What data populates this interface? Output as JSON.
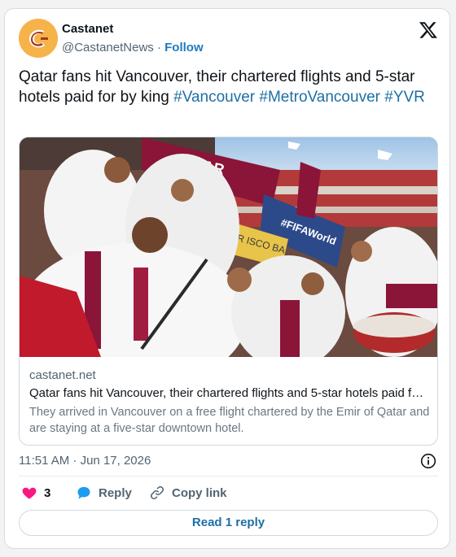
{
  "author": {
    "name": "Castanet",
    "handle": "@CastanetNews",
    "separator": "·",
    "follow_label": "Follow"
  },
  "tweet": {
    "text": "Qatar fans hit Vancouver, their chartered flights and 5-star hotels paid for by king",
    "hashtags": [
      "#Vancouver",
      "#MetroVancouver",
      "#YVR"
    ]
  },
  "link_card": {
    "domain": "castanet.net",
    "title": "Qatar fans hit Vancouver, their chartered flights and 5-star hotels paid f…",
    "description": "They arrived in Vancouver on a free flight chartered by the Emir of Qatar and are staying at a five-star downtown hotel.",
    "photo_banner_text": "QATAR",
    "photo_sign_text": "#FIFAWorld",
    "photo_board_text": "AN FR   ISCO BA"
  },
  "timestamp": "11:51 AM · Jun 17, 2026",
  "actions": {
    "like_count": "3",
    "reply_label": "Reply",
    "copy_link_label": "Copy link"
  },
  "read_replies_label": "Read 1 reply",
  "colors": {
    "accent": "#1d6fa5",
    "like": "#f91880",
    "reply": "#1d9bf0",
    "maroon": "#8a1538"
  },
  "icons": [
    "castanet-logo",
    "x-logo-icon",
    "info-icon",
    "heart-icon",
    "reply-bubble-icon",
    "link-icon"
  ]
}
